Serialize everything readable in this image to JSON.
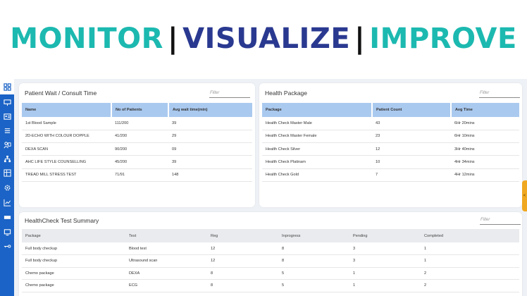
{
  "headline": {
    "word1": "MONITOR",
    "sep1": "|",
    "word2": "VISUALIZE",
    "sep2": "|",
    "word3": "IMPROVE"
  },
  "colors": {
    "teal": "#1cb9b0",
    "navy": "#2a3990",
    "sidebar": "#1b63c6",
    "header_blue": "#aac9ef",
    "handle": "#f0a820"
  },
  "sidebar": {
    "icons": [
      "dashboard-icon",
      "monitor-icon",
      "id-card-icon",
      "list-icon",
      "users-icon",
      "hierarchy-icon",
      "grid-icon",
      "settings-icon",
      "chart-icon",
      "card-icon",
      "display-icon",
      "key-icon"
    ]
  },
  "patient_wait": {
    "title": "Patient Wait / Consult Time",
    "filter_placeholder": "Filter",
    "columns": [
      "Name",
      "No of Patients",
      "Avg wait time(min)"
    ],
    "rows": [
      [
        "1st Blood Sample",
        "111/200",
        "39"
      ],
      [
        "2D-ECHO WITH COLOUR DOPPLE",
        "41/200",
        "29"
      ],
      [
        "DEXA SCAN",
        "90/200",
        "09"
      ],
      [
        "AHC LIFE STYLE COUNSELLING",
        "45/200",
        "39"
      ],
      [
        "TREAD MILL STRESS TEST",
        "71/91",
        "148"
      ]
    ]
  },
  "health_package": {
    "title": "Health Package",
    "filter_placeholder": "Filter",
    "columns": [
      "Package",
      "Patient Count",
      "Avg Time"
    ],
    "rows": [
      [
        "Health Check Master Male",
        "43",
        "6Hr 20mins"
      ],
      [
        "Health Check Master Female",
        "23",
        "6Hr 10mins"
      ],
      [
        "Health Check Silver",
        "12",
        "3Hr 40mins"
      ],
      [
        "Health Check Platinam",
        "10",
        "4Hr 34mins"
      ],
      [
        "Health Check Gold",
        "7",
        "4Hr 12mins"
      ]
    ]
  },
  "test_summary": {
    "title": "HealthCheck Test Summary",
    "filter_placeholder": "Filter",
    "columns": [
      "Package",
      "Test",
      "Reg",
      "Inprogress",
      "Pending",
      "Completed"
    ],
    "rows": [
      [
        "Full body checkup",
        "Blood test",
        "12",
        "8",
        "3",
        "1"
      ],
      [
        "Full body checkup",
        "Ultrasound scan",
        "12",
        "8",
        "3",
        "1"
      ],
      [
        "Chemo package",
        "DEXA",
        "8",
        "5",
        "1",
        "2"
      ],
      [
        "Chemo package",
        "ECG",
        "8",
        "5",
        "1",
        "2"
      ]
    ]
  },
  "handle": {
    "label": "<"
  }
}
